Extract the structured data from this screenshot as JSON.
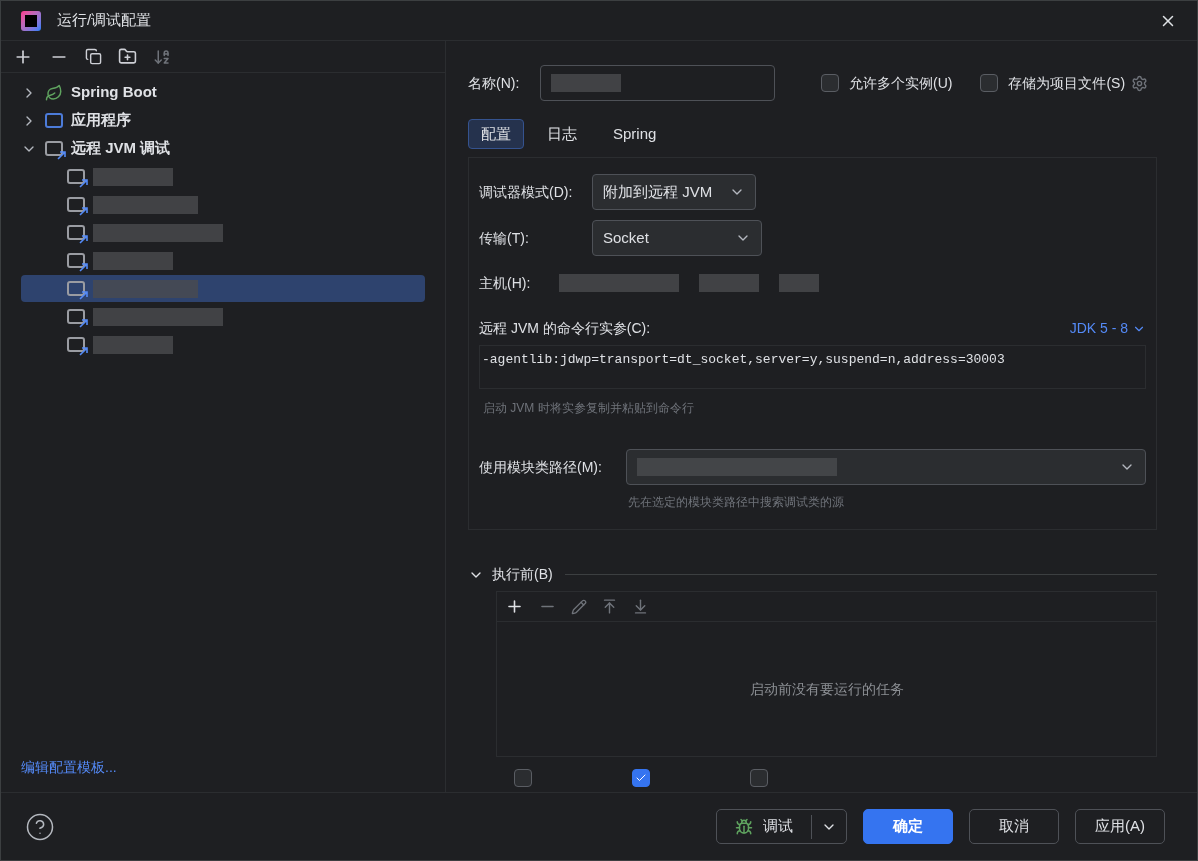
{
  "window": {
    "title": "运行/调试配置"
  },
  "tree": [
    {
      "label": "Spring Boot",
      "kind": "spring",
      "expanded": false
    },
    {
      "label": "应用程序",
      "kind": "app",
      "expanded": false
    },
    {
      "label": "远程 JVM 调试",
      "kind": "remote",
      "expanded": true,
      "children": [
        {
          "selected": false
        },
        {
          "selected": false
        },
        {
          "selected": false
        },
        {
          "selected": false
        },
        {
          "selected": true
        },
        {
          "selected": false
        },
        {
          "selected": false
        }
      ]
    }
  ],
  "template_link": "编辑配置模板...",
  "name_field": {
    "label": "名称(N):"
  },
  "options": [
    {
      "label": "允许多个实例(U)",
      "checked": false
    },
    {
      "label": "存储为项目文件(S)",
      "checked": false
    }
  ],
  "tabs": [
    {
      "label": "配置",
      "selected": true
    },
    {
      "label": "日志",
      "selected": false
    },
    {
      "label": "Spring",
      "selected": false
    }
  ],
  "debugger_mode": {
    "label": "调试器模式(D):",
    "value": "附加到远程 JVM"
  },
  "transport": {
    "label": "传输(T):",
    "value": "Socket"
  },
  "host": {
    "label": "主机(H):"
  },
  "args": {
    "label": "远程 JVM 的命令行实参(C):",
    "jdk": "JDK 5 - 8",
    "value": "-agentlib:jdwp=transport=dt_socket,server=y,suspend=n,address=30003",
    "hint": "启动 JVM 时将实参复制并粘贴到命令行"
  },
  "module": {
    "label": "使用模块类路径(M):",
    "hint": "先在选定的模块类路径中搜索调试类的源"
  },
  "before_launch": {
    "title": "执行前(B)",
    "expanded": true,
    "empty_text": "启动前没有要运行的任务"
  },
  "launch_options": [
    {
      "checked": false
    },
    {
      "checked": true
    },
    {
      "checked": false
    }
  ],
  "buttons": [
    {
      "label": "调试",
      "kind": "split"
    },
    {
      "label": "确定",
      "kind": "primary"
    },
    {
      "label": "取消",
      "kind": "default"
    },
    {
      "label": "应用(A)",
      "kind": "default"
    }
  ]
}
